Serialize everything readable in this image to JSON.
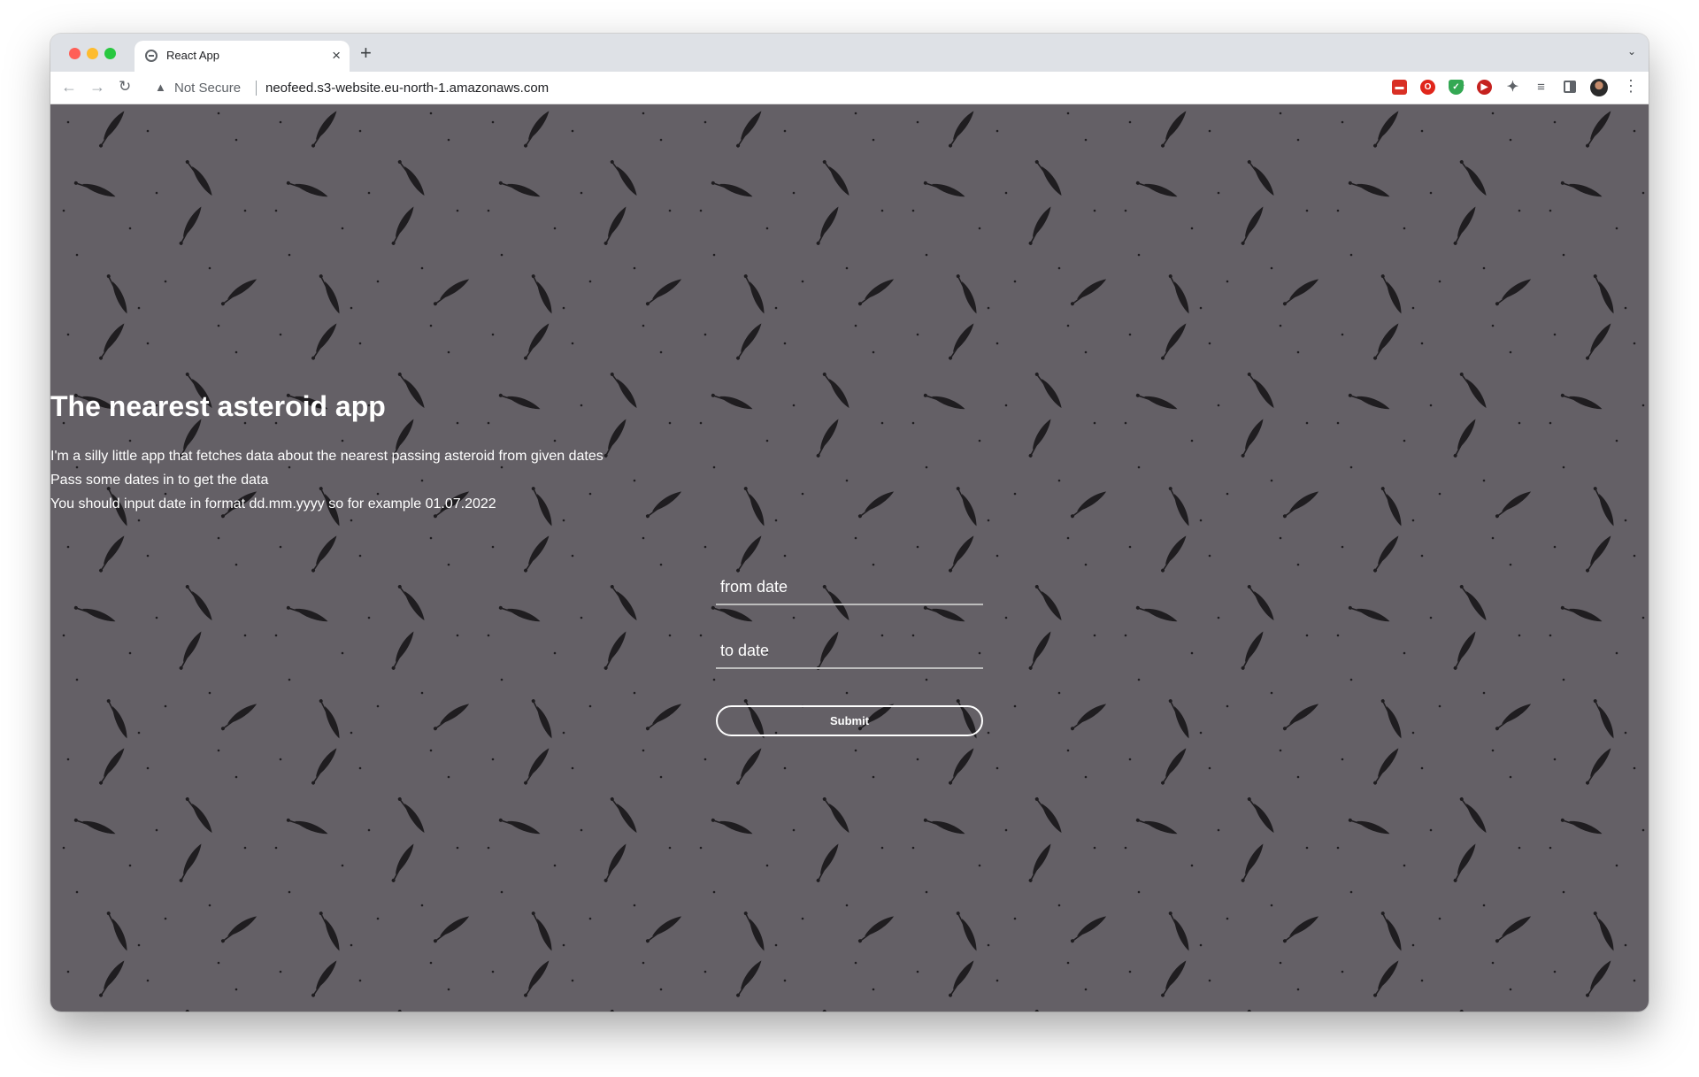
{
  "browser": {
    "tab_title": "React App",
    "tab_close": "×",
    "new_tab": "+",
    "tab_list_icon": "⌄",
    "security_label": "Not Secure",
    "url": "neofeed.s3-website.eu-north-1.amazonaws.com",
    "back_icon": "←",
    "forward_icon": "→",
    "reload_icon": "↻",
    "warning_icon": "▲",
    "share_icon": "⇪",
    "star_icon": "☆",
    "puzzle_icon": "✦",
    "queue_icon": "≡",
    "menu_icon": "⋮",
    "extensions": [
      "red-ext-icon",
      "opera-icon",
      "shield-icon",
      "play-icon",
      "puzzle-icon",
      "queue-icon",
      "side-panel-icon",
      "profile-avatar"
    ]
  },
  "page": {
    "title": "The nearest asteroid app",
    "description_lines": [
      "I'm a silly little app that fetches data about the nearest passing asteroid from given dates",
      "Pass some dates in to get the data",
      "You should input date in format dd.mm.yyyy so for example 01.07.2022"
    ],
    "from_placeholder": "from date",
    "to_placeholder": "to date",
    "submit_label": "Submit",
    "background_color": "#646066"
  }
}
